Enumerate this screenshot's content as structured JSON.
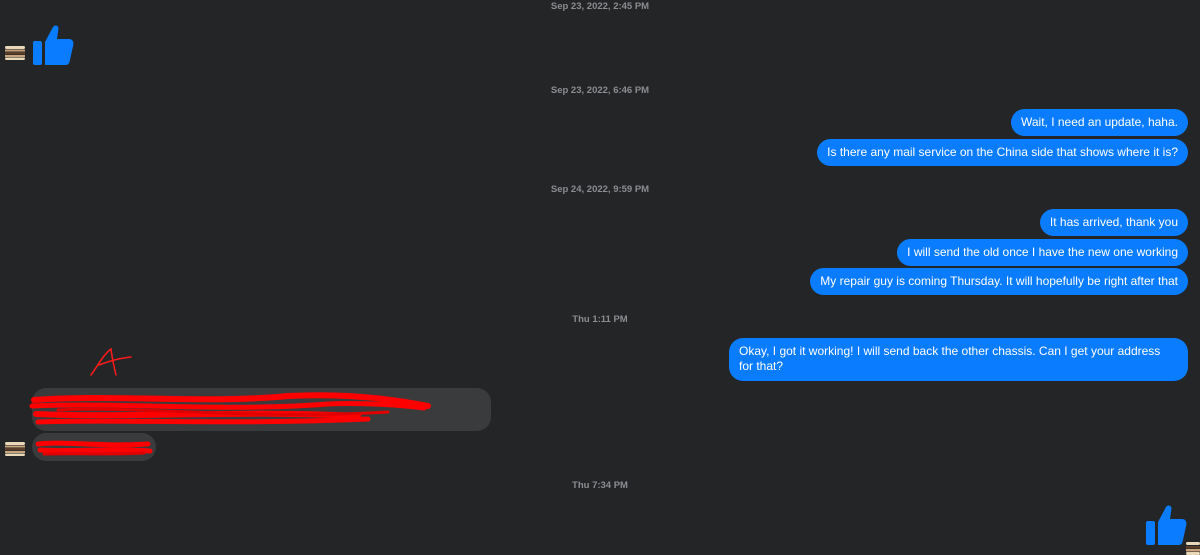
{
  "timestamps": {
    "t1": "Sep 23, 2022, 2:45 PM",
    "t2": "Sep 23, 2022, 6:46 PM",
    "t3": "Sep 24, 2022, 9:59 PM",
    "t4": "Thu 1:11 PM",
    "t5": "Thu 7:34 PM"
  },
  "messages": {
    "m1": "Wait, I need an update, haha.",
    "m2": "Is there any mail service on the China side that shows where it is?",
    "m3": "It has arrived, thank you",
    "m4": "I will send the old once I have the new one working",
    "m5": "My repair guy is coming Thursday. It will hopefully be right after that",
    "m6": "Okay, I got it working! I will send back the other chassis. Can I get your address for that?"
  },
  "annotation": {
    "letter": "A"
  },
  "colors": {
    "background": "#242526",
    "outgoing_bubble": "#0a7cff",
    "incoming_bubble": "#3a3b3c",
    "redaction": "#ff0000",
    "timestamp": "#8a8d91"
  },
  "icons": [
    "thumbs-up-icon",
    "contact-avatar-icon"
  ]
}
